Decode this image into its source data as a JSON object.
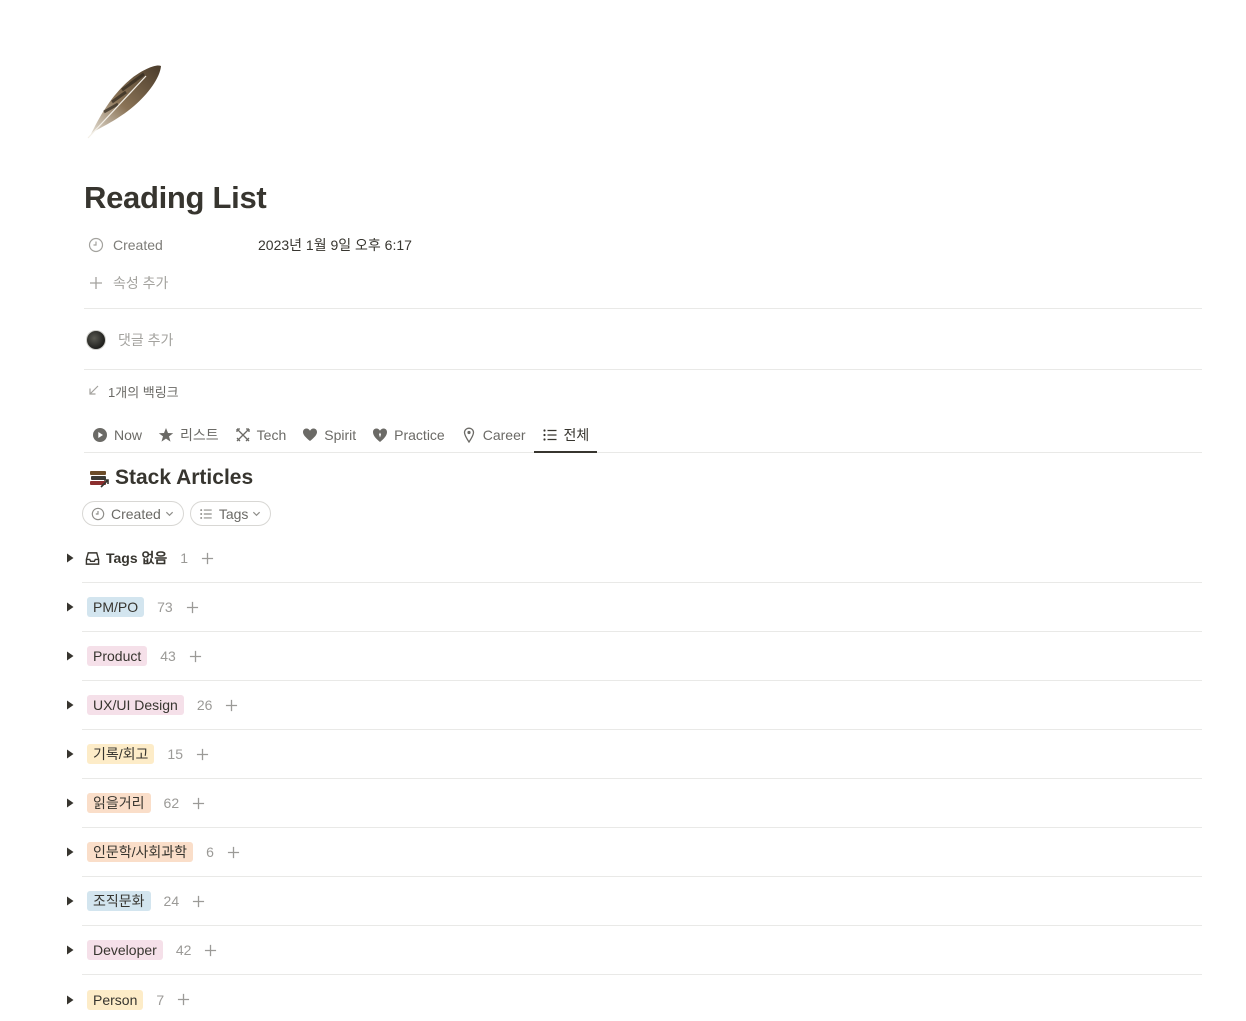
{
  "page": {
    "title": "Reading List",
    "icon": "feather-icon"
  },
  "properties": {
    "created_label": "Created",
    "created_value": "2023년 1월 9일 오후 6:17",
    "add_property_label": "속성 추가"
  },
  "comments": {
    "add_comment_placeholder": "댓글 추가"
  },
  "backlinks": {
    "label": "1개의 백링크"
  },
  "tabs": [
    {
      "label": "Now",
      "icon": "play-circle-icon",
      "active": false
    },
    {
      "label": "리스트",
      "icon": "star-icon",
      "active": false
    },
    {
      "label": "Tech",
      "icon": "crossed-swords-icon",
      "active": false
    },
    {
      "label": "Spirit",
      "icon": "heart-icon",
      "active": false
    },
    {
      "label": "Practice",
      "icon": "heart-shield-icon",
      "active": false
    },
    {
      "label": "Career",
      "icon": "map-pin-icon",
      "active": false
    },
    {
      "label": "전체",
      "icon": "list-icon",
      "active": true
    }
  ],
  "view": {
    "title": "Stack Articles",
    "icon": "stacked-books-icon"
  },
  "filters": [
    {
      "label": "Created",
      "icon": "clock-icon"
    },
    {
      "label": "Tags",
      "icon": "list-icon"
    }
  ],
  "groups": [
    {
      "label": "Tags 없음",
      "count": "1",
      "color": null
    },
    {
      "label": "PM/PO",
      "count": "73",
      "color": "#d3e5ef"
    },
    {
      "label": "Product",
      "count": "43",
      "color": "#f5e0e9"
    },
    {
      "label": "UX/UI Design",
      "count": "26",
      "color": "#f5e0e9"
    },
    {
      "label": "기록/회고",
      "count": "15",
      "color": "#fdecc8"
    },
    {
      "label": "읽을거리",
      "count": "62",
      "color": "#fadec9"
    },
    {
      "label": "인문학/사회과학",
      "count": "6",
      "color": "#fadec9"
    },
    {
      "label": "조직문화",
      "count": "24",
      "color": "#d3e5ef"
    },
    {
      "label": "Developer",
      "count": "42",
      "color": "#f5e0e9"
    },
    {
      "label": "Person",
      "count": "7",
      "color": "#fdecc8"
    }
  ]
}
